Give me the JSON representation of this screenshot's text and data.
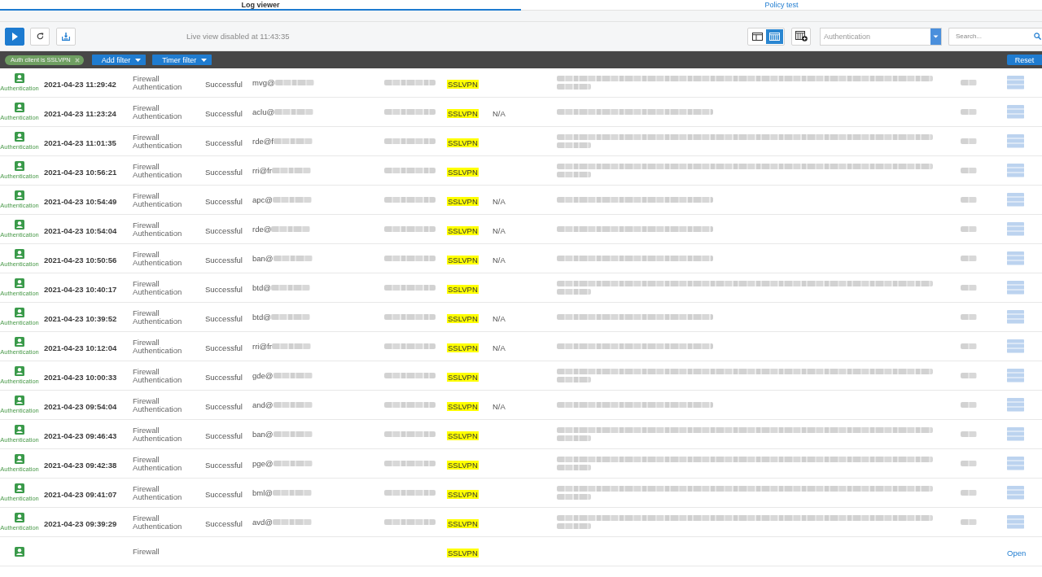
{
  "tabs": [
    {
      "label": "Log viewer",
      "selected": true
    },
    {
      "label": "Policy test",
      "selected": false
    }
  ],
  "toolbar": {
    "buttons": [
      {
        "kind": "play"
      },
      {
        "kind": "refresh"
      },
      {
        "kind": "export"
      }
    ],
    "status": "Live view disabled at 11:43:35",
    "view_toggles": [
      {
        "kind": "split",
        "selected": false
      },
      {
        "kind": "table",
        "selected": true
      }
    ],
    "log_type_dropdown": {
      "value": "Authentication"
    },
    "search": {
      "placeholder": "Search..."
    }
  },
  "filters": {
    "chips": [
      {
        "label": "Auth client is SSLVPN"
      }
    ],
    "menus": [
      {
        "label": "Add filter"
      },
      {
        "label": "Timer filter"
      }
    ],
    "reset": "Reset"
  },
  "rows": [
    {
      "component": "Authentication",
      "time": "2021-04-23 11:29:42",
      "log_type": "Firewall Authentication",
      "status": "Successful",
      "user": "mvg@",
      "client": "SSLVPN",
      "message_wraps": true,
      "redacted": true
    },
    {
      "component": "Authentication",
      "time": "2021-04-23 11:23:24",
      "log_type": "Firewall Authentication",
      "status": "Successful",
      "user": "aclu@",
      "client": "SSLVPN",
      "mechanism": "N/A",
      "message_wraps": false,
      "redacted": true
    },
    {
      "component": "Authentication",
      "time": "2021-04-23 11:01:35",
      "log_type": "Firewall Authentication",
      "status": "Successful",
      "user": "rde@f",
      "client": "SSLVPN",
      "message_wraps": true,
      "redacted": true
    },
    {
      "component": "Authentication",
      "time": "2021-04-23 10:56:21",
      "log_type": "Firewall Authentication",
      "status": "Successful",
      "user": "rri@fr",
      "client": "SSLVPN",
      "message_wraps": true,
      "redacted": true
    },
    {
      "component": "Authentication",
      "time": "2021-04-23 10:54:49",
      "log_type": "Firewall Authentication",
      "status": "Successful",
      "user": "apc@",
      "client": "SSLVPN",
      "mechanism": "N/A",
      "message_wraps": false,
      "redacted": true
    },
    {
      "component": "Authentication",
      "time": "2021-04-23 10:54:04",
      "log_type": "Firewall Authentication",
      "status": "Successful",
      "user": "rde@",
      "client": "SSLVPN",
      "mechanism": "N/A",
      "message_wraps": false,
      "redacted": true
    },
    {
      "component": "Authentication",
      "time": "2021-04-23 10:50:56",
      "log_type": "Firewall Authentication",
      "status": "Successful",
      "user": "ban@",
      "client": "SSLVPN",
      "mechanism": "N/A",
      "message_wraps": false,
      "redacted": true
    },
    {
      "component": "Authentication",
      "time": "2021-04-23 10:40:17",
      "log_type": "Firewall Authentication",
      "status": "Successful",
      "user": "btd@",
      "client": "SSLVPN",
      "message_wraps": true,
      "redacted": true
    },
    {
      "component": "Authentication",
      "time": "2021-04-23 10:39:52",
      "log_type": "Firewall Authentication",
      "status": "Successful",
      "user": "btd@",
      "client": "SSLVPN",
      "mechanism": "N/A",
      "message_wraps": false,
      "redacted": true
    },
    {
      "component": "Authentication",
      "time": "2021-04-23 10:12:04",
      "log_type": "Firewall Authentication",
      "status": "Successful",
      "user": "rri@fr",
      "client": "SSLVPN",
      "mechanism": "N/A",
      "message_wraps": false,
      "redacted": true
    },
    {
      "component": "Authentication",
      "time": "2021-04-23 10:00:33",
      "log_type": "Firewall Authentication",
      "status": "Successful",
      "user": "gde@",
      "client": "SSLVPN",
      "message_wraps": true,
      "redacted": true
    },
    {
      "component": "Authentication",
      "time": "2021-04-23 09:54:04",
      "log_type": "Firewall Authentication",
      "status": "Successful",
      "user": "and@",
      "client": "SSLVPN",
      "mechanism": "N/A",
      "message_wraps": false,
      "redacted": true
    },
    {
      "component": "Authentication",
      "time": "2021-04-23 09:46:43",
      "log_type": "Firewall Authentication",
      "status": "Successful",
      "user": "ban@",
      "client": "SSLVPN",
      "message_wraps": true,
      "redacted": true
    },
    {
      "component": "Authentication",
      "time": "2021-04-23 09:42:38",
      "log_type": "Firewall Authentication",
      "status": "Successful",
      "user": "pge@",
      "client": "SSLVPN",
      "message_wraps": true,
      "redacted": true
    },
    {
      "component": "Authentication",
      "time": "2021-04-23 09:41:07",
      "log_type": "Firewall Authentication",
      "status": "Successful",
      "user": "bml@",
      "client": "SSLVPN",
      "message_wraps": true,
      "redacted": true
    },
    {
      "component": "Authentication",
      "time": "2021-04-23 09:39:29",
      "log_type": "Firewall Authentication",
      "status": "Successful",
      "user": "avd@",
      "client": "SSLVPN",
      "message_wraps": true,
      "redacted": true
    },
    {
      "log_type": "Firewall",
      "client": "SSLVPN",
      "link": "Open",
      "redacted": false
    }
  ]
}
